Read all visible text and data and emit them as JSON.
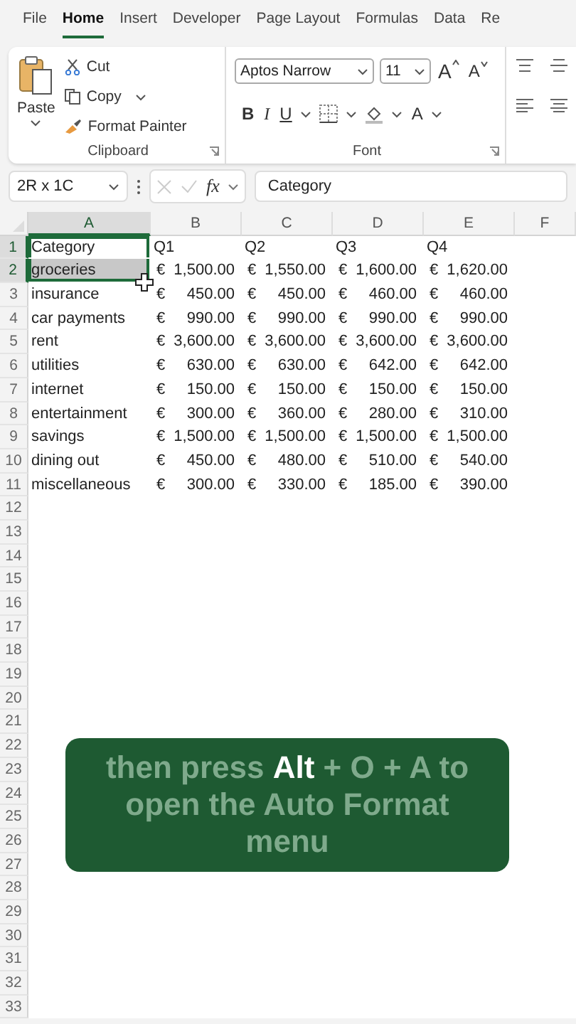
{
  "menu_tabs": [
    {
      "label": "File",
      "selected": false
    },
    {
      "label": "Home",
      "selected": true
    },
    {
      "label": "Insert",
      "selected": false
    },
    {
      "label": "Developer",
      "selected": false
    },
    {
      "label": "Page Layout",
      "selected": false
    },
    {
      "label": "Formulas",
      "selected": false
    },
    {
      "label": "Data",
      "selected": false
    },
    {
      "label": "Re",
      "selected": false
    }
  ],
  "ribbon": {
    "clipboard": {
      "paste": "Paste",
      "cut": "Cut",
      "copy": "Copy",
      "format_painter": "Format Painter",
      "label": "Clipboard"
    },
    "font": {
      "name": "Aptos Narrow",
      "size": "11",
      "grow": "A",
      "shrink": "A",
      "bold": "B",
      "italic": "I",
      "underline": "U",
      "font_color": "A",
      "label": "Font"
    }
  },
  "formula_bar": {
    "name_box": "2R x 1C",
    "fx": "fx",
    "value": "Category"
  },
  "grid": {
    "columns": [
      {
        "label": "A",
        "selected": true
      },
      {
        "label": "B",
        "selected": false
      },
      {
        "label": "C",
        "selected": false
      },
      {
        "label": "D",
        "selected": false
      },
      {
        "label": "E",
        "selected": false
      },
      {
        "label": "F",
        "selected": false
      }
    ],
    "rows": [
      {
        "number": "1",
        "selected": true,
        "cells": [
          {
            "text": "Category"
          },
          {
            "text": "Q1"
          },
          {
            "text": "Q2"
          },
          {
            "text": "Q3"
          },
          {
            "text": "Q4"
          }
        ]
      },
      {
        "number": "2",
        "selected": true,
        "cells": [
          {
            "text": "groceries"
          },
          {
            "symbol": "€",
            "amount": "1,500.00"
          },
          {
            "symbol": "€",
            "amount": "1,550.00"
          },
          {
            "symbol": "€",
            "amount": "1,600.00"
          },
          {
            "symbol": "€",
            "amount": "1,620.00"
          }
        ]
      },
      {
        "number": "3",
        "selected": false,
        "cells": [
          {
            "text": "insurance"
          },
          {
            "symbol": "€",
            "amount": "450.00"
          },
          {
            "symbol": "€",
            "amount": "450.00"
          },
          {
            "symbol": "€",
            "amount": "460.00"
          },
          {
            "symbol": "€",
            "amount": "460.00"
          }
        ]
      },
      {
        "number": "4",
        "selected": false,
        "cells": [
          {
            "text": "car payments"
          },
          {
            "symbol": "€",
            "amount": "990.00"
          },
          {
            "symbol": "€",
            "amount": "990.00"
          },
          {
            "symbol": "€",
            "amount": "990.00"
          },
          {
            "symbol": "€",
            "amount": "990.00"
          }
        ]
      },
      {
        "number": "5",
        "selected": false,
        "cells": [
          {
            "text": "rent"
          },
          {
            "symbol": "€",
            "amount": "3,600.00"
          },
          {
            "symbol": "€",
            "amount": "3,600.00"
          },
          {
            "symbol": "€",
            "amount": "3,600.00"
          },
          {
            "symbol": "€",
            "amount": "3,600.00"
          }
        ]
      },
      {
        "number": "6",
        "selected": false,
        "cells": [
          {
            "text": "utilities"
          },
          {
            "symbol": "€",
            "amount": "630.00"
          },
          {
            "symbol": "€",
            "amount": "630.00"
          },
          {
            "symbol": "€",
            "amount": "642.00"
          },
          {
            "symbol": "€",
            "amount": "642.00"
          }
        ]
      },
      {
        "number": "7",
        "selected": false,
        "cells": [
          {
            "text": "internet"
          },
          {
            "symbol": "€",
            "amount": "150.00"
          },
          {
            "symbol": "€",
            "amount": "150.00"
          },
          {
            "symbol": "€",
            "amount": "150.00"
          },
          {
            "symbol": "€",
            "amount": "150.00"
          }
        ]
      },
      {
        "number": "8",
        "selected": false,
        "cells": [
          {
            "text": "entertainment"
          },
          {
            "symbol": "€",
            "amount": "300.00"
          },
          {
            "symbol": "€",
            "amount": "360.00"
          },
          {
            "symbol": "€",
            "amount": "280.00"
          },
          {
            "symbol": "€",
            "amount": "310.00"
          }
        ]
      },
      {
        "number": "9",
        "selected": false,
        "cells": [
          {
            "text": "savings"
          },
          {
            "symbol": "€",
            "amount": "1,500.00"
          },
          {
            "symbol": "€",
            "amount": "1,500.00"
          },
          {
            "symbol": "€",
            "amount": "1,500.00"
          },
          {
            "symbol": "€",
            "amount": "1,500.00"
          }
        ]
      },
      {
        "number": "10",
        "selected": false,
        "cells": [
          {
            "text": "dining out"
          },
          {
            "symbol": "€",
            "amount": "450.00"
          },
          {
            "symbol": "€",
            "amount": "480.00"
          },
          {
            "symbol": "€",
            "amount": "510.00"
          },
          {
            "symbol": "€",
            "amount": "540.00"
          }
        ]
      },
      {
        "number": "11",
        "selected": false,
        "cells": [
          {
            "text": "miscellaneous"
          },
          {
            "symbol": "€",
            "amount": "300.00"
          },
          {
            "symbol": "€",
            "amount": "330.00"
          },
          {
            "symbol": "€",
            "amount": "185.00"
          },
          {
            "symbol": "€",
            "amount": "390.00"
          }
        ]
      },
      {
        "number": "12",
        "selected": false
      },
      {
        "number": "13",
        "selected": false
      },
      {
        "number": "14",
        "selected": false
      },
      {
        "number": "15",
        "selected": false
      },
      {
        "number": "16",
        "selected": false
      },
      {
        "number": "17",
        "selected": false
      },
      {
        "number": "18",
        "selected": false
      },
      {
        "number": "19",
        "selected": false
      },
      {
        "number": "20",
        "selected": false
      },
      {
        "number": "21",
        "selected": false
      },
      {
        "number": "22",
        "selected": false
      },
      {
        "number": "23",
        "selected": false
      },
      {
        "number": "24",
        "selected": false
      },
      {
        "number": "25",
        "selected": false
      },
      {
        "number": "26",
        "selected": false
      },
      {
        "number": "27",
        "selected": false
      },
      {
        "number": "28",
        "selected": false
      },
      {
        "number": "29",
        "selected": false
      },
      {
        "number": "30",
        "selected": false
      },
      {
        "number": "31",
        "selected": false
      },
      {
        "number": "32",
        "selected": false
      },
      {
        "number": "33",
        "selected": false
      }
    ]
  },
  "caption": "then press **Alt** + O + A to open the Auto Format menu"
}
